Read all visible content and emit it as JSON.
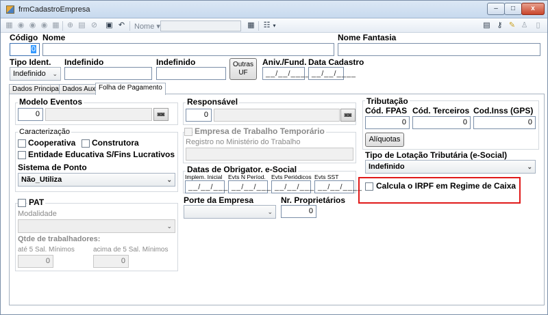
{
  "window": {
    "title": "frmCadastroEmpresa",
    "controls": {
      "minimize": "–",
      "maximize": "□",
      "close": "x"
    }
  },
  "toolbar": {
    "name_label": "Nome",
    "name_dropdown_arrow": "▾",
    "icons": [
      "first-record-icon",
      "previous-record-icon",
      "next-record-icon",
      "last-record-icon",
      "new-record-icon",
      "edit-record-icon",
      "delete-record-icon",
      "save-icon",
      "undo-icon",
      "search-icon",
      "grid-view-icon",
      "report-icon",
      "layout-icon",
      "key-icon",
      "edit-icon",
      "user-icon",
      "exit-icon"
    ]
  },
  "header": {
    "codigo_label": "Código",
    "codigo_value": "0",
    "nome_label": "Nome",
    "nome_value": "",
    "nome_fantasia_label": "Nome Fantasia",
    "nome_fantasia_value": "",
    "tipo_ident_label": "Tipo Ident.",
    "tipo_ident_value": "Indefinido",
    "indefinido1_label": "Indefinido",
    "indefinido2_label": "Indefinido",
    "outras_uf_label_line1": "Outras",
    "outras_uf_label_line2": "UF",
    "aniv_label": "Aniv./Fund.",
    "aniv_value": "__/__/____",
    "data_cadastro_label": "Data Cadastro",
    "data_cadastro_value": "__/__/____"
  },
  "tabs": [
    {
      "label": "Dados Principais",
      "active": false
    },
    {
      "label": "Dados Aux.",
      "active": false
    },
    {
      "label": "Folha de Pagamento",
      "active": true
    }
  ],
  "folha": {
    "modelo_eventos_label": "Modelo Eventos",
    "modelo_eventos_value": "0",
    "caracterizacao_title": "Caracterização",
    "cooperativa_label": "Cooperativa",
    "construtora_label": "Construtora",
    "entidade_label": "Entidade Educativa S/Fins Lucrativos",
    "sistema_ponto_label": "Sistema de Ponto",
    "sistema_ponto_value": "Não_Utiliza",
    "pat_label": "PAT",
    "modalidade_label": "Modalidade",
    "qtde_trab_label": "Qtde de trabalhadores:",
    "ate5_label": "até 5 Sal. Mínimos",
    "ate5_value": "0",
    "acima5_label": "acima de 5 Sal. Mínimos",
    "acima5_value": "0",
    "responsavel_label": "Responsável",
    "responsavel_value": "0",
    "empresa_temp_label": "Empresa de Trabalho Temporário",
    "registro_mt_label": "Registro no Ministério do Trabalho",
    "datas_obrig_title": "Datas de Obrigator. e-Social",
    "implem_inicial_label": "Implem. Inicial",
    "evts_n_period_label": "Evts N Períod.",
    "evts_periodicos_label": "Evts Periódicos",
    "evts_sst_label": "Evts SST",
    "date_placeholder": "__/__/____",
    "porte_label": "Porte da Empresa",
    "nr_proprietarios_label": "Nr. Proprietários",
    "nr_proprietarios_value": "0",
    "tributacao_title": "Tributação",
    "cod_fpas_label": "Cód. FPAS",
    "cod_fpas_value": "0",
    "cod_terceiros_label": "Cód. Terceiros",
    "cod_terceiros_value": "0",
    "cod_inss_label": "Cod.Inss (GPS)",
    "cod_inss_value": "0",
    "aliquotas_label": "Alíquotas",
    "tipo_lotacao_label": "Tipo de Lotação Tributária (e-Social)",
    "tipo_lotacao_value": "Indefinido",
    "calcula_irpf_label": "Calcula o IRPF em Regime de Caixa"
  },
  "colors": {
    "highlight": "#e01818",
    "selection": "#3399ff"
  }
}
